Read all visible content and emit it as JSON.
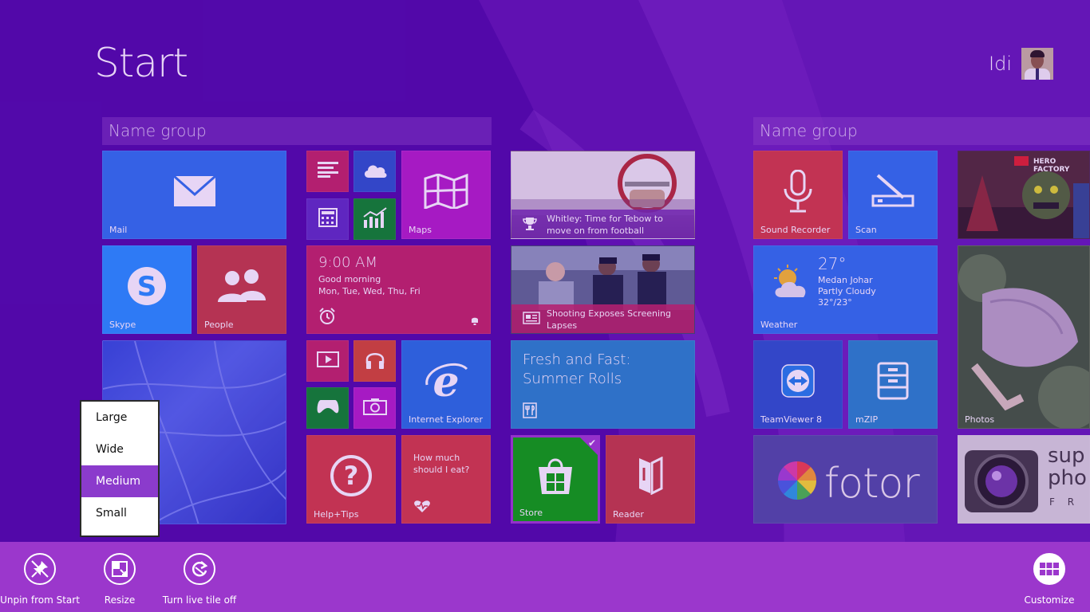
{
  "screen": {
    "title": "Start",
    "user_name": "Idi"
  },
  "groups": [
    {
      "name": "Name group"
    },
    {
      "name": "Name group"
    }
  ],
  "tiles": {
    "mail": {
      "label": "Mail",
      "color": "#2672ec"
    },
    "skype": {
      "label": "Skype",
      "color": "#1e90ff"
    },
    "people": {
      "label": "People",
      "color": "#d24726"
    },
    "maps": {
      "label": "Maps",
      "color": "#b01bc2"
    },
    "alarm": {
      "time": "9:00 AM",
      "message": "Good morning",
      "days": "Mon, Tue, Wed, Thu, Fri",
      "color": "#c0225d"
    },
    "internet_explorer": {
      "label": "Internet Explorer",
      "color": "#1e6fe0"
    },
    "help_tips": {
      "label": "Help+Tips",
      "color": "#d23a3a"
    },
    "health": {
      "question": "How much should I eat?",
      "color": "#d23a3a"
    },
    "news_sports": {
      "caption": "Whitley: Time for Tebow to move on from football"
    },
    "news_photo": {
      "caption": "Shooting Exposes Screening Lapses"
    },
    "food": {
      "title": "Fresh and Fast: Summer Rolls",
      "color": "#1f85c8"
    },
    "store": {
      "label": "Store",
      "color": "#00a600"
    },
    "reader": {
      "label": "Reader",
      "color": "#c23a3a"
    },
    "sound_recorder": {
      "label": "Sound Recorder",
      "color": "#d23a3a"
    },
    "scan": {
      "label": "Scan",
      "color": "#2672ec"
    },
    "weather": {
      "label": "Weather",
      "temp": "27°",
      "location": "Medan Johar",
      "condition": "Partly Cloudy",
      "range": "32°/23°",
      "color": "#2672ec"
    },
    "teamviewer": {
      "label": "TeamViewer 8",
      "color": "#2451c8"
    },
    "mzip": {
      "label": "mZIP",
      "color": "#1f85c8"
    },
    "fotor": {
      "brand": "fotor",
      "color": "#4a4aa0"
    },
    "photos": {
      "label": "Photos"
    },
    "hero_factory": {
      "brand": "HERO FACTORY"
    },
    "super_photo": {
      "brand_line1": "sup",
      "brand_line2": "pho",
      "brand_line3": "F R"
    }
  },
  "resize_menu": {
    "items": [
      "Large",
      "Wide",
      "Medium",
      "Small"
    ],
    "selected": "Medium"
  },
  "appbar": {
    "unpin_label": "Unpin from Start",
    "resize_label": "Resize",
    "live_tile_label": "Turn live tile off",
    "customize_label": "Customize"
  }
}
